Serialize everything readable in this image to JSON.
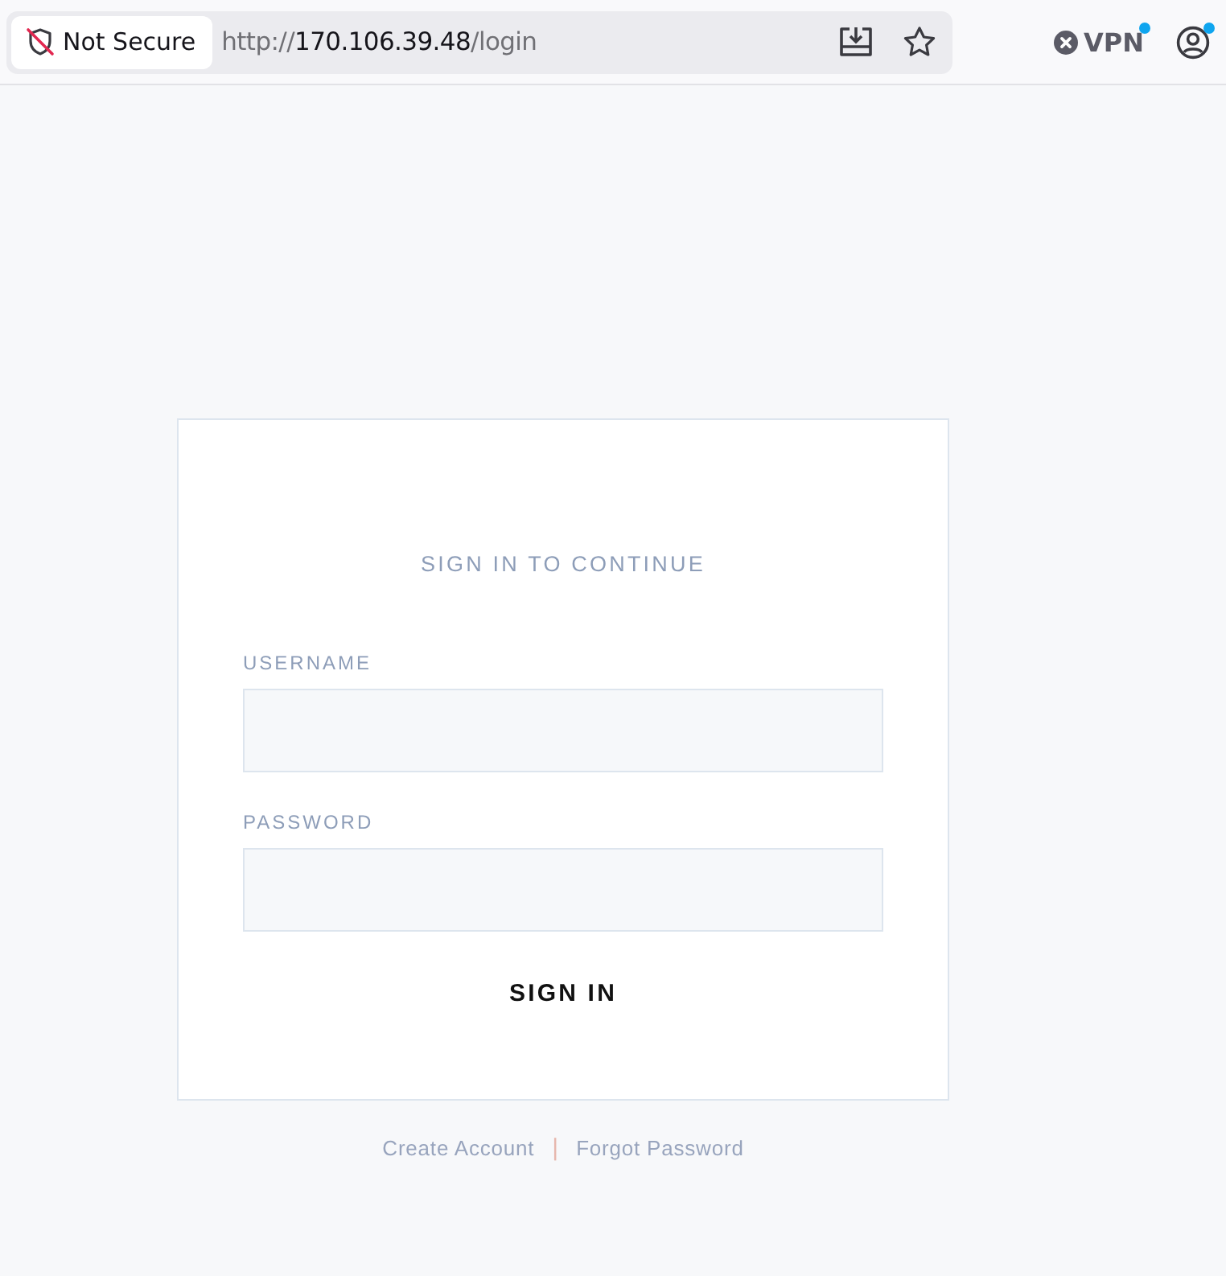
{
  "browser": {
    "security_badge": "Not Secure",
    "url_parts": [
      {
        "text": "http://",
        "emphasis": false
      },
      {
        "text": "170.106.39.48",
        "emphasis": true
      },
      {
        "text": "/login",
        "emphasis": false
      }
    ],
    "vpn": {
      "label": "VPN",
      "notification": true
    },
    "profile": {
      "notification": true
    }
  },
  "login": {
    "title": "SIGN IN TO CONTINUE",
    "fields": [
      {
        "label": "USERNAME"
      },
      {
        "label": "PASSWORD"
      }
    ],
    "submit": "SIGN IN"
  },
  "footer": {
    "links": [
      "Create Account",
      "Forgot Password"
    ],
    "separator": "|"
  }
}
